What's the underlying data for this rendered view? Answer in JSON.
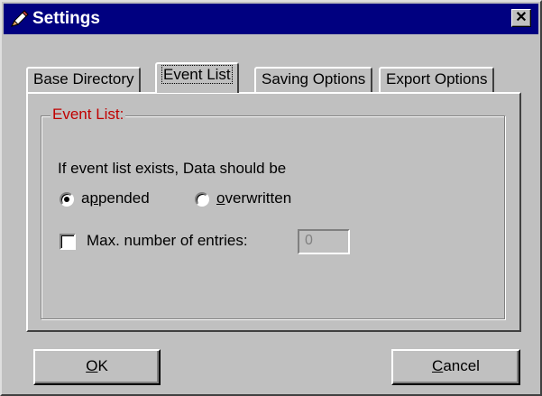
{
  "window": {
    "title": "Settings",
    "close_glyph": "✕",
    "icon": "pencil-settings-icon"
  },
  "tabs": [
    {
      "label": "Base Directory",
      "active": false
    },
    {
      "label": "Event List",
      "active": true
    },
    {
      "label": "Saving Options",
      "active": false
    },
    {
      "label": "Export Options",
      "active": false
    }
  ],
  "event_list": {
    "group_label": "Event List:",
    "prompt": "If event list exists, Data should be",
    "options": [
      {
        "pre": "a",
        "mnemonic": "p",
        "post": "pended",
        "selected": true
      },
      {
        "pre": "",
        "mnemonic": "o",
        "post": "verwritten",
        "selected": false
      }
    ],
    "max_entries": {
      "label": "Max. number of entries:",
      "checked": false,
      "value": "0",
      "enabled": false
    }
  },
  "buttons": {
    "ok": {
      "mnemonic": "O",
      "rest": "K"
    },
    "cancel": {
      "mnemonic": "C",
      "rest": "ancel"
    }
  },
  "colors": {
    "title_bar": "#000080",
    "group_label": "#c00000",
    "face": "#c0c0c0"
  }
}
